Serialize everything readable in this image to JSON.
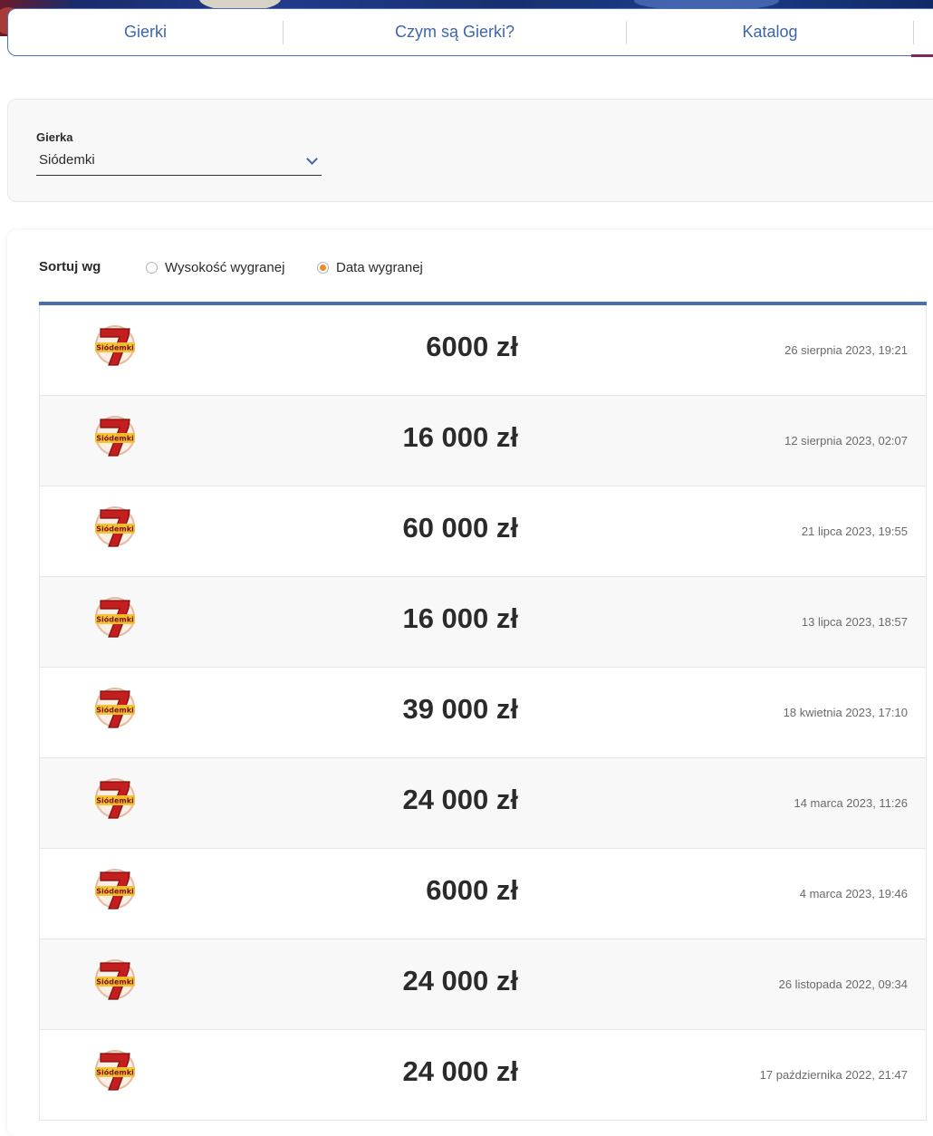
{
  "tabs": {
    "items": [
      "Gierki",
      "Czym są Gierki?",
      "Katalog"
    ]
  },
  "filter": {
    "label": "Gierka",
    "selected": "Siódemki"
  },
  "sort": {
    "label": "Sortuj wg",
    "options": [
      "Wysokość wygranej",
      "Data wygranej"
    ],
    "selected_index": 1
  },
  "game_logo": {
    "icon": "siodemki-logo-icon",
    "text": "Siódemki"
  },
  "results": [
    {
      "amount": "6000 zł",
      "date": "26 sierpnia 2023, 19:21"
    },
    {
      "amount": "16 000 zł",
      "date": "12 sierpnia 2023, 02:07"
    },
    {
      "amount": "60 000 zł",
      "date": "21 lipca 2023, 19:55"
    },
    {
      "amount": "16 000 zł",
      "date": "13 lipca 2023, 18:57"
    },
    {
      "amount": "39 000 zł",
      "date": "18 kwietnia 2023, 17:10"
    },
    {
      "amount": "24 000 zł",
      "date": "14 marca 2023, 11:26"
    },
    {
      "amount": "6000 zł",
      "date": "4 marca 2023, 19:46"
    },
    {
      "amount": "24 000 zł",
      "date": "26 listopada 2022, 09:34"
    },
    {
      "amount": "24 000 zł",
      "date": "17 października 2022, 21:47"
    }
  ],
  "colors": {
    "accent_blue": "#4a6fb0",
    "radio_checked": "#f08a24",
    "logo_red": "#c41e1e",
    "logo_gold": "#f2c12e"
  }
}
